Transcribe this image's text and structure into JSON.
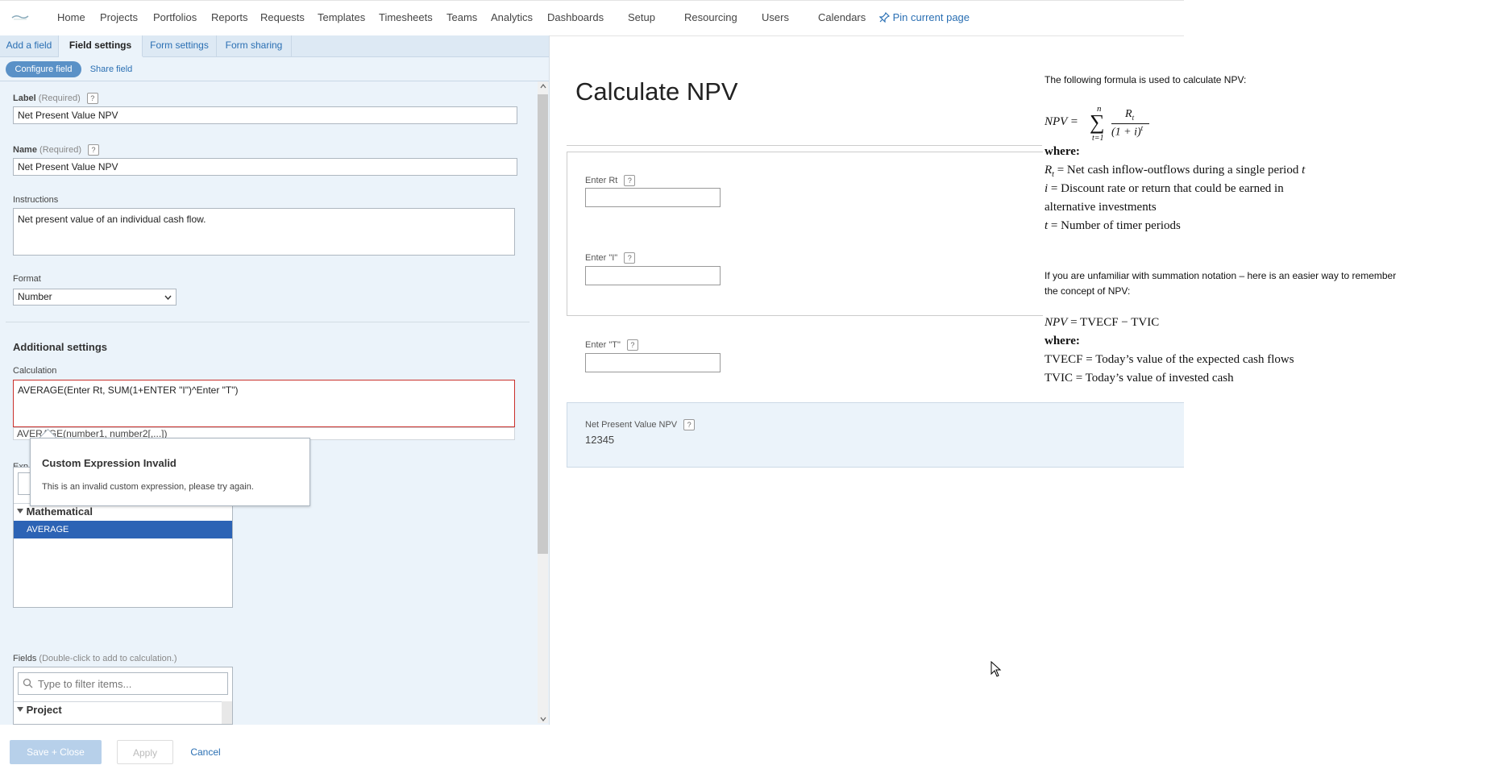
{
  "nav": {
    "items": [
      "Home",
      "Projects",
      "Portfolios",
      "Reports",
      "Requests",
      "Templates",
      "Timesheets",
      "Teams",
      "Analytics",
      "Dashboards",
      "Setup",
      "Resourcing",
      "Users",
      "Calendars"
    ],
    "pin_label": "Pin current page"
  },
  "left": {
    "tabs": [
      "Add a field",
      "Field settings",
      "Form settings",
      "Form sharing"
    ],
    "subtabs": [
      "Configure field",
      "Share field"
    ],
    "label_field": {
      "label": "Label",
      "req": "(Required)",
      "value": "Net Present Value NPV"
    },
    "name_field": {
      "label": "Name",
      "req": "(Required)",
      "value": "Net Present Value NPV"
    },
    "instructions": {
      "label": "Instructions",
      "value": "Net present value of an individual cash flow."
    },
    "format": {
      "label": "Format",
      "value": "Number"
    },
    "additional_settings": "Additional settings",
    "calculation": {
      "label": "Calculation",
      "value": "AVERAGE(Enter Rt, SUM(1+ENTER \"I\")^Enter \"T\")",
      "hint": "AVERAGE(number1, number2[,...])"
    },
    "expressions_label_partial": "Exp",
    "tooltip": {
      "title": "Custom Expression Invalid",
      "body": "This is an invalid custom expression, please try again."
    },
    "expr_list": {
      "group": "Mathematical",
      "selected": "AVERAGE"
    },
    "fields": {
      "label": "Fields",
      "hint": "(Double-click to add to calculation.)",
      "placeholder": "Type to filter items...",
      "group": "Project"
    }
  },
  "buttons": {
    "save": "Save + Close",
    "apply": "Apply",
    "cancel": "Cancel"
  },
  "form": {
    "title": "Calculate NPV",
    "enter_rt": "Enter Rt",
    "enter_i": "Enter \"I\"",
    "enter_t": "Enter \"T\"",
    "npv_label": "Net Present Value NPV",
    "npv_value": "12345"
  },
  "formula": {
    "intro": "The following formula is used to calculate NPV:",
    "npv_lhs": "NPV =",
    "sigma_top": "n",
    "sigma_bot": "t=1",
    "frac_num": "R",
    "frac_num_sub": "t",
    "frac_den": "(1 + i)",
    "frac_den_sup": "t",
    "where1": "where:",
    "def_r_sym": "R",
    "def_r_sub": "t",
    "def_r": " = Net cash inflow-outflows during a single period ",
    "def_r_t": "t",
    "def_i_sym": "i",
    "def_i": " = Discount rate or return that could be earned in",
    "def_i2": "alternative investments",
    "def_t_sym": "t",
    "def_t": " = Number of timer periods",
    "intro2a": "If you are unfamiliar with summation notation – here is an easier way to remember",
    "intro2b": "the concept of NPV:",
    "npv2_lhs": "NPV",
    "npv2_rhs": " = TVECF − TVIC",
    "where2": "where:",
    "def_tvecf": "TVECF = Today’s value of the expected cash flows",
    "def_tvic": "TVIC = Today’s value of invested cash"
  },
  "colors": {
    "accent": "#2a6fb3",
    "selected": "#2c63b5",
    "panel": "#ebf3fa",
    "error": "#c9302c"
  }
}
